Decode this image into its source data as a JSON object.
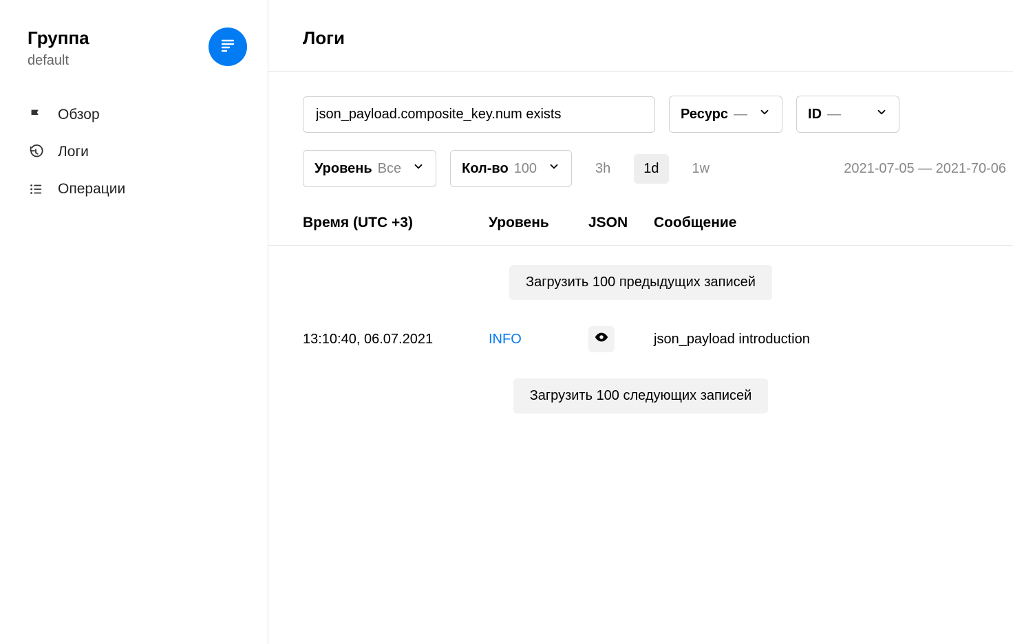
{
  "sidebar": {
    "group_label": "Группа",
    "group_name": "default",
    "items": [
      {
        "label": "Обзор"
      },
      {
        "label": "Логи"
      },
      {
        "label": "Операции"
      }
    ]
  },
  "page": {
    "title": "Логи"
  },
  "filters": {
    "query": "json_payload.composite_key.num exists",
    "resource": {
      "label": "Ресурс",
      "value": "—"
    },
    "id": {
      "label": "ID",
      "value": "—"
    },
    "level": {
      "label": "Уровень",
      "value": "Все"
    },
    "count": {
      "label": "Кол-во",
      "value": "100"
    },
    "ranges": [
      "3h",
      "1d",
      "1w"
    ],
    "active_range": "1d",
    "date_range": "2021-07-05 — 2021-70-06"
  },
  "table": {
    "headers": {
      "time": "Время (UTC +3)",
      "level": "Уровень",
      "json": "JSON",
      "message": "Сообщение"
    },
    "load_prev": "Загрузить 100 предыдущих записей",
    "load_next": "Загрузить 100 следующих записей",
    "rows": [
      {
        "time": "13:10:40, 06.07.2021",
        "level": "INFO",
        "message": "json_payload introduction"
      }
    ]
  }
}
